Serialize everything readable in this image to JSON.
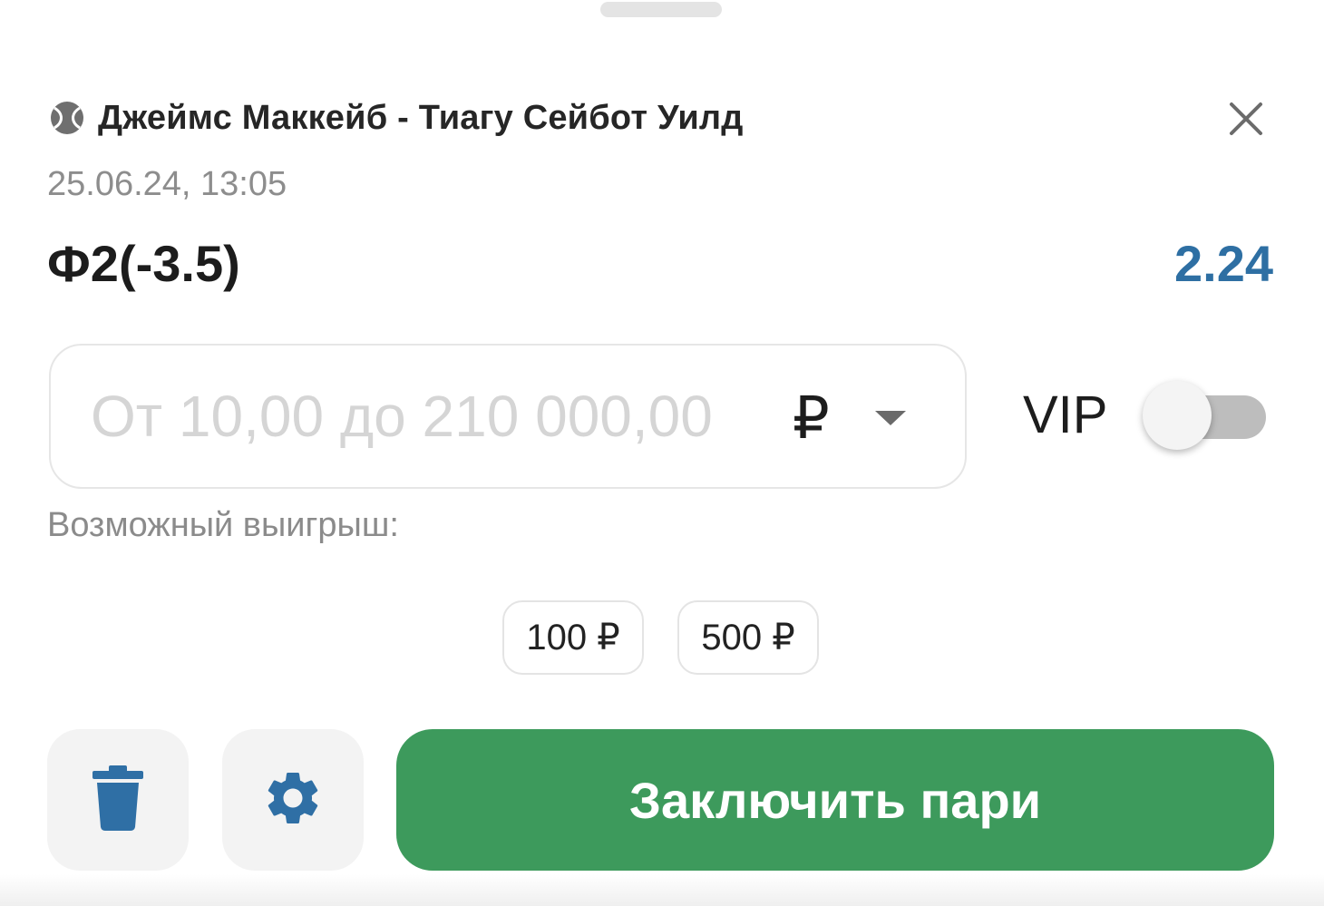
{
  "sheet": {
    "match_title": "Джеймс Маккейб - Тиагу Сейбот Уилд",
    "datetime": "25.06.24,  13:05",
    "bet_name": "Ф2(-3.5)",
    "odds": "2.24",
    "sport_icon": "tennis-ball-icon",
    "close_icon": "close-icon"
  },
  "stake": {
    "placeholder": "От 10,00 до 210 000,00",
    "value": "",
    "currency": "₽",
    "dropdown_icon": "caret-down-icon"
  },
  "vip": {
    "label": "VIP",
    "enabled": false
  },
  "possible_win_label": "Возможный выигрыш:",
  "quick_amounts": [
    "100 ₽",
    "500 ₽"
  ],
  "actions": {
    "delete_icon": "trash-icon",
    "settings_icon": "gear-icon",
    "submit_label": "Заключить пари"
  },
  "colors": {
    "accent_green": "#3d9a5c",
    "odds_blue": "#2e6fa3",
    "icon_blue": "#2f6fa5"
  }
}
